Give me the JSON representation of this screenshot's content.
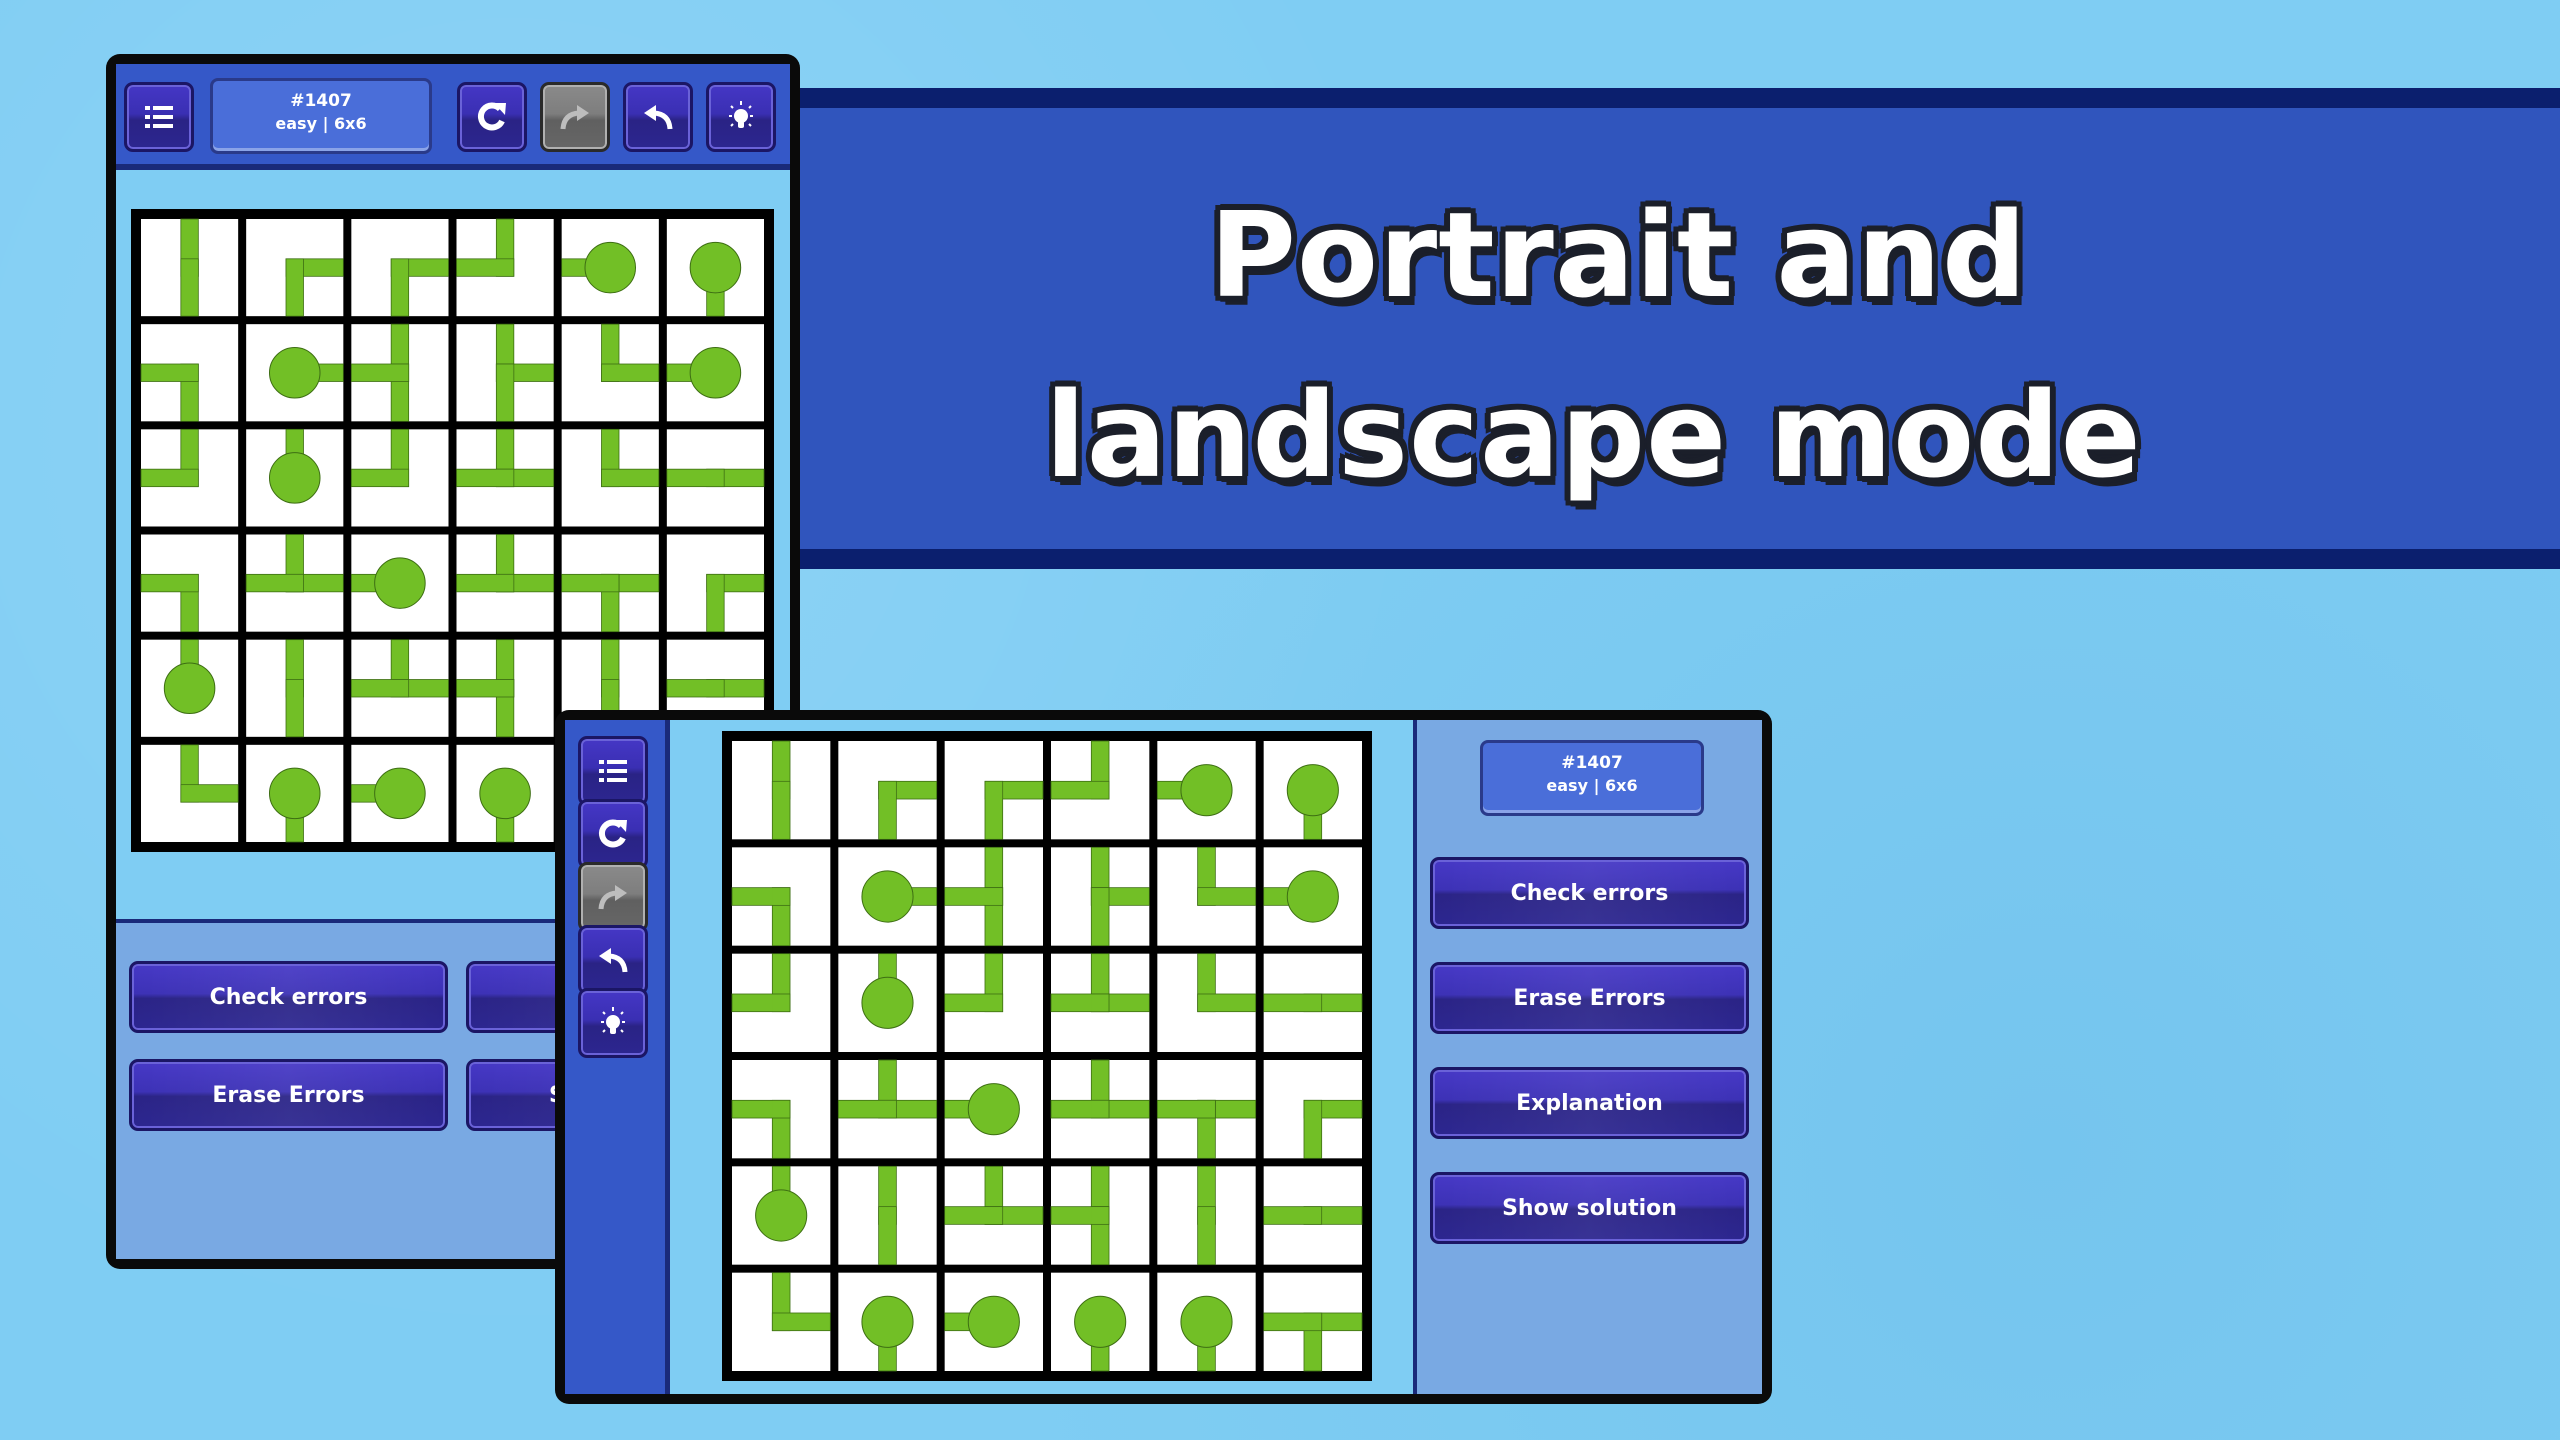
{
  "banner": {
    "line1": "Portrait and",
    "line2": "landscape mode"
  },
  "puzzle": {
    "number": "#1407",
    "info": "easy | 6x6"
  },
  "toolbar": {
    "menu": "menu-icon",
    "restart": "restart-icon",
    "redo": "redo-icon",
    "undo": "undo-icon",
    "hint": "hint-lightbulb-icon",
    "redo_disabled": true
  },
  "actions": {
    "check_errors": "Check errors",
    "erase_errors": "Erase Errors",
    "explanation": "Explanation",
    "show_solution": "Show solution",
    "partial_s": "S"
  },
  "colors": {
    "pipe": "#72bf26",
    "pipe_outline": "#3d6e13",
    "tile": "#ffffff",
    "grid_line": "#000000",
    "banner": "#3055bd",
    "banner_stripe": "#0b1f6e",
    "background": "#7fcdf3"
  },
  "grid": {
    "size": 6,
    "legend": "each cell lists pipe connections N/E/S/W; 'end' marks a terminal node",
    "cells": [
      [
        {
          "c": "NS"
        },
        {
          "c": "ES"
        },
        {
          "c": "ES"
        },
        {
          "c": "NW"
        },
        {
          "c": "W",
          "end": true
        },
        {
          "c": "S",
          "end": true
        }
      ],
      [
        {
          "c": "SW"
        },
        {
          "c": "E",
          "end": true
        },
        {
          "c": "NSW"
        },
        {
          "c": "NES"
        },
        {
          "c": "NE"
        },
        {
          "c": "W",
          "end": true
        }
      ],
      [
        {
          "c": "NW"
        },
        {
          "c": "N",
          "end": true
        },
        {
          "c": "NW"
        },
        {
          "c": "NEW"
        },
        {
          "c": "NE"
        },
        {
          "c": "EW"
        }
      ],
      [
        {
          "c": "SW"
        },
        {
          "c": "NEW"
        },
        {
          "c": "W",
          "end": true
        },
        {
          "c": "NEW"
        },
        {
          "c": "ESW"
        },
        {
          "c": "ES"
        }
      ],
      [
        {
          "c": "N",
          "end": true
        },
        {
          "c": "NS"
        },
        {
          "c": "NEW"
        },
        {
          "c": "NSW"
        },
        {
          "c": "NS"
        },
        {
          "c": "EW"
        }
      ],
      [
        {
          "c": "NE"
        },
        {
          "c": "S",
          "end": true
        },
        {
          "c": "W",
          "end": true
        },
        {
          "c": "S",
          "end": true
        },
        {
          "c": "S",
          "end": true
        },
        {
          "c": "ESW"
        }
      ]
    ]
  }
}
